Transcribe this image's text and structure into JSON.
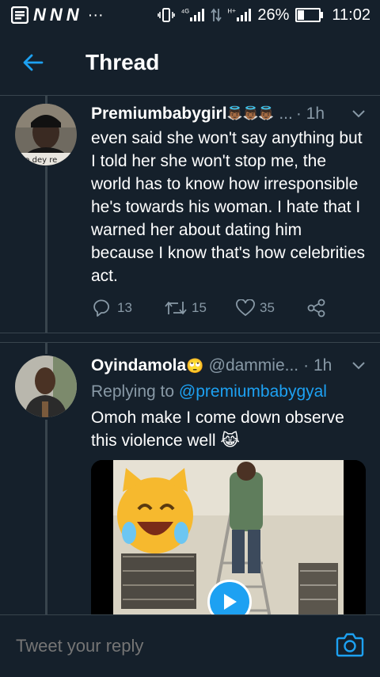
{
  "status_bar": {
    "n_icons": [
      "N",
      "N",
      "N"
    ],
    "dots": "···",
    "net1": "⁴ᴳ",
    "net2": "ᴴ⁺",
    "battery": "26%",
    "battery_level": 0.26,
    "time": "11:02"
  },
  "header": {
    "title": "Thread"
  },
  "tweets": [
    {
      "name": "Premiumbabygirl",
      "emojis": "👼🏾👼🏾👼🏾",
      "handle": "...",
      "time": "· 1h",
      "avatar_caption": "no dey re",
      "text": "even said she won't say anything but I told her she won't stop me, the world has to know how irresponsible he's towards his woman. I hate that I warned her about dating him because I know that's how celebrities act.",
      "replies": "13",
      "retweets": "15",
      "likes": "35"
    },
    {
      "name": "Oyindamola",
      "emojis": "🙄",
      "handle": "@dammie...",
      "time": "· 1h",
      "replying_prefix": "Replying to",
      "replying_to": "@premiumbabygyal",
      "text": "Omoh make I come down observe this violence well 😹"
    }
  ],
  "reply_bar": {
    "placeholder": "Tweet your reply"
  },
  "colors": {
    "background": "#15202b",
    "accent": "#1da1f2",
    "muted": "#8899a6",
    "divider": "#38444d"
  }
}
